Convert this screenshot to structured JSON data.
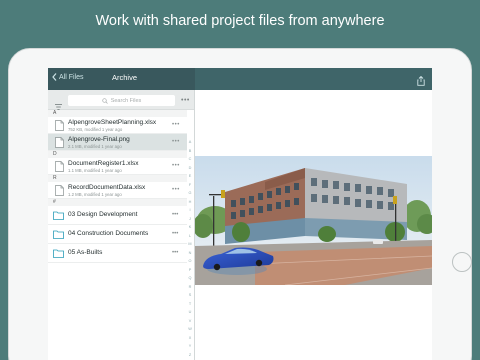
{
  "headline": "Work with shared project files from anywhere",
  "nav": {
    "back_label": "All Files",
    "title": "Archive",
    "share_icon": "share-icon"
  },
  "search": {
    "placeholder": "Search Files"
  },
  "sections": [
    {
      "letter": "A",
      "files": [
        {
          "name": "AlpengroveSheetPlanning.xlsx",
          "meta": "752 KB, modified 1 year ago",
          "selected": false
        },
        {
          "name": "Alpengrove-Final.png",
          "meta": "2.1 MB, modified 1 year ago",
          "selected": true
        }
      ]
    },
    {
      "letter": "D",
      "files": [
        {
          "name": "DocumentRegister1.xlsx",
          "meta": "1.1 MB, modified 1 year ago",
          "selected": false
        }
      ]
    },
    {
      "letter": "R",
      "files": [
        {
          "name": "RecordDocumentData.xlsx",
          "meta": "1.2 MB, modified 1 year ago",
          "selected": false
        }
      ]
    },
    {
      "letter": "#",
      "folders": [
        {
          "name": "03 Design Development"
        },
        {
          "name": "04 Construction Documents"
        },
        {
          "name": "05 As-Builts"
        }
      ]
    }
  ],
  "index_letters": [
    "A",
    "B",
    "C",
    "D",
    "E",
    "F",
    "G",
    "H",
    "I",
    "J",
    "K",
    "L",
    "M",
    "N",
    "O",
    "P",
    "Q",
    "R",
    "S",
    "T",
    "U",
    "V",
    "W",
    "X",
    "Y",
    "Z",
    "#"
  ],
  "colors": {
    "background": "#4d7c7a",
    "nav_bar": "#39585d",
    "accent": "#2a9db8"
  }
}
